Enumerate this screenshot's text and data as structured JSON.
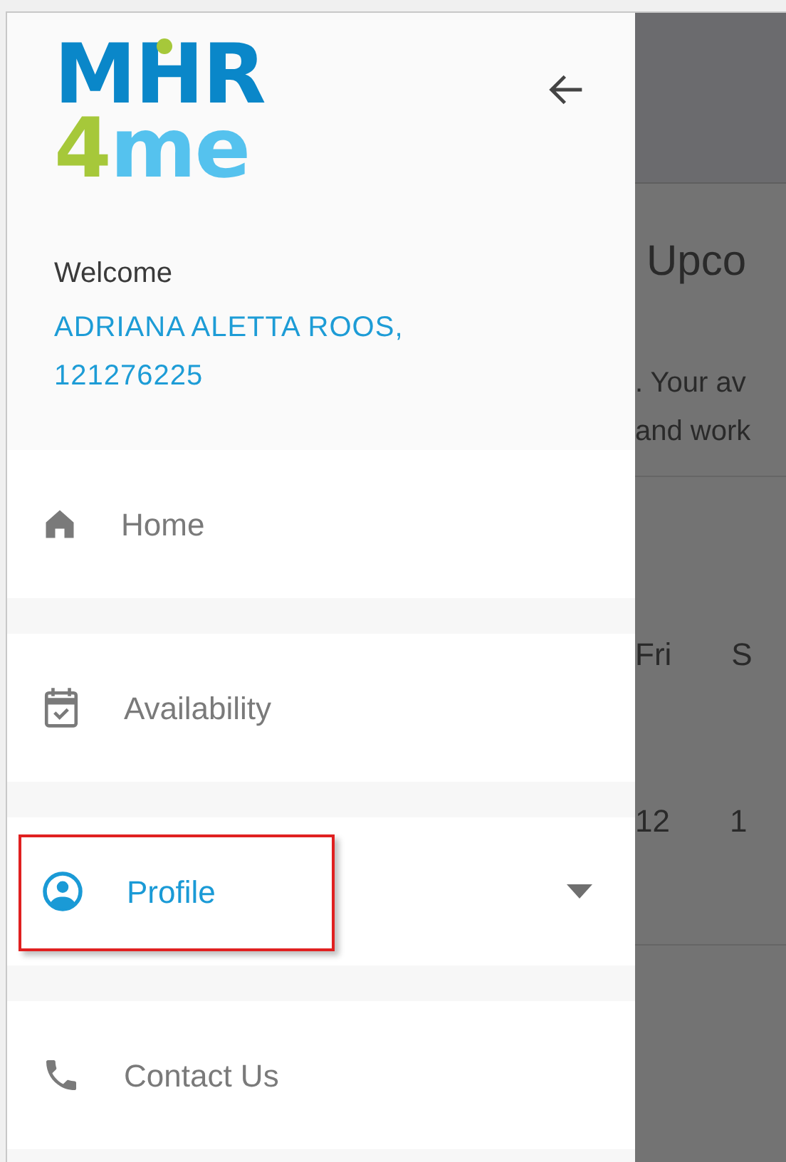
{
  "drawer": {
    "logo": {
      "top": "MHR",
      "digit": "4",
      "rest": "me"
    },
    "welcome": "Welcome",
    "user": "ADRIANA ALETTA ROOS, 121276225",
    "items": [
      {
        "kind": "home",
        "label": "Home",
        "selected": false,
        "highlighted": false
      },
      {
        "kind": "calendar",
        "label": "Availability",
        "selected": false,
        "highlighted": false
      },
      {
        "kind": "profile",
        "label": "Profile",
        "selected": true,
        "highlighted": true,
        "expanded": false
      },
      {
        "kind": "phone",
        "label": "Contact Us",
        "selected": false,
        "highlighted": false
      }
    ]
  },
  "background": {
    "heading": "Upco",
    "lines": [
      ". Your av",
      "and work"
    ],
    "days": [
      "Fri",
      "S"
    ],
    "dates": [
      "12",
      "1"
    ]
  }
}
